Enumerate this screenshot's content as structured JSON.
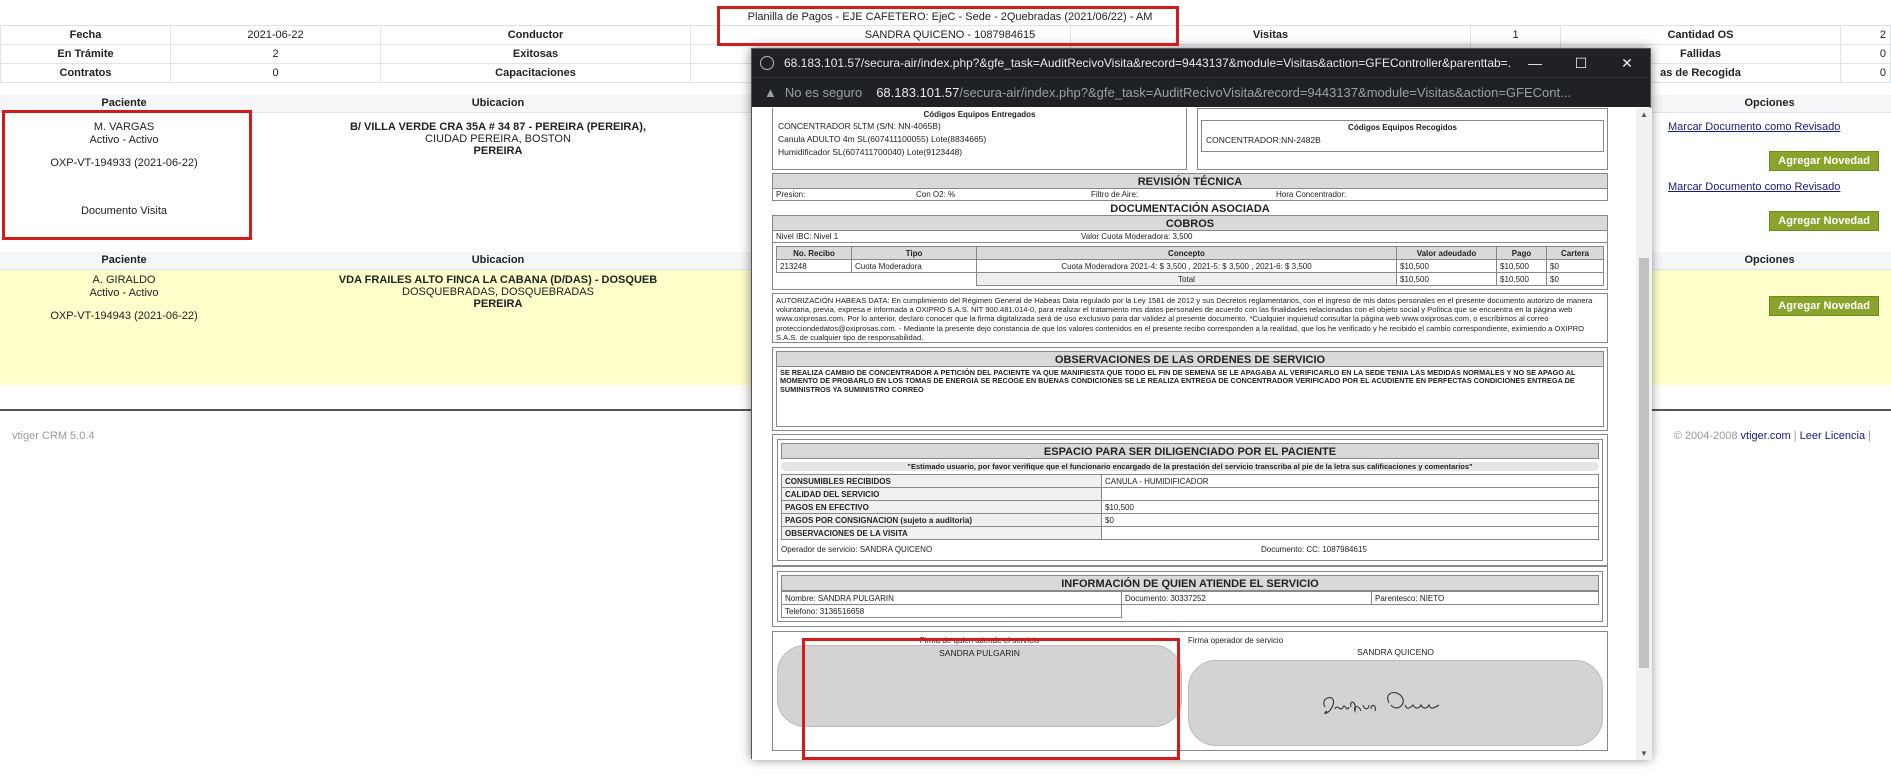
{
  "header": {
    "title": "Planilla de Pagos - EJE CAFETERO: EjeC - Sede - 2Quebradas (2021/06/22) - AM",
    "operator": "SANDRA QUICENO - 1087984615",
    "rows": [
      {
        "c1": "Fecha",
        "c2": "2021-06-22",
        "c3": "Conductor",
        "c4": "",
        "c5": "Visitas",
        "c6": "1",
        "c7": "Cantidad OS",
        "c8": "2"
      },
      {
        "c1": "En Trámite",
        "c2": "2",
        "c3": "Exitosas",
        "c4": "",
        "c5": "",
        "c6": "",
        "c7": "Fallidas",
        "c8": "0"
      },
      {
        "c1": "Contratos",
        "c2": "0",
        "c3": "Capacitaciones",
        "c4": "",
        "c5": "",
        "c6": "",
        "c7": "as de Recogida",
        "c8": "0"
      }
    ]
  },
  "table": {
    "col_paciente": "Paciente",
    "col_ubicacion": "Ubicacion",
    "col_opciones": "Opciones",
    "rows": [
      {
        "name": "M. VARGAS",
        "status": "Activo - Activo",
        "code": "OXP-VT-194933 (2021-06-22)",
        "doc": "Documento Visita",
        "addr1": "B/ VILLA VERDE CRA 35A # 34 87 - PEREIRA (PEREIRA),",
        "addr2": "CIUDAD PEREIRA, BOSTON",
        "addr3": "PEREIRA"
      },
      {
        "name": "A. GIRALDO",
        "status": "Activo - Activo",
        "code": "OXP-VT-194943 (2021-06-22)",
        "addr1": "VDA FRAILES ALTO FINCA LA CABANA (D/DAS) - DOSQUEB",
        "addr2": "DOSQUEBRADAS, DOSQUEBRADAS",
        "addr3": "PEREIRA"
      }
    ],
    "mark_link": "Marcar Documento como Revisado",
    "add_btn": "Agregar Novedad"
  },
  "footer": {
    "left": "vtiger CRM 5.0.4",
    "copy": "© 2004-2008",
    "site": "vtiger.com",
    "license": "Leer Licencia",
    "sep": "|"
  },
  "popup": {
    "title": "68.183.101.57/secura-air/index.php?&gfe_task=AuditRecivoVisita&record=9443137&module=Visitas&action=GFEController&parenttab=...",
    "insecure": "No es seguro",
    "url_host": "68.183.101.57",
    "url_path": "/secura-air/index.php?&gfe_task=AuditRecivoVisita&record=9443137&module=Visitas&action=GFECont...",
    "equip_deliv_title": "Códigos Equipos Entregados",
    "equip_deliv_1": "CONCENTRADOR 5LTM (S/N: NN-4065B)",
    "equip_deliv_2": "Canula ADULTO 4m SL(607411100055) Lote(8834665)",
    "equip_deliv_3": "Humidificador SL(607411700040) Lote(9123448)",
    "equip_pick_title": "Códigos Equipos Recogidos",
    "equip_pick_1": "CONCENTRADOR:NN-2482B",
    "rev_tec": "REVISIÓN TÉCNICA",
    "presion": "Presion:",
    "con_o2": "Con O2: %",
    "filtro": "Filtro de Aire:",
    "hora": "Hora Concentrador:",
    "doc_asoc": "DOCUMENTACIÓN ASOCIADA",
    "cobros": "COBROS",
    "nivel_ibc": "Nivel IBC: Nivel 1",
    "valor_cuota": "Valor Cuota Moderadora: 3,500",
    "cob_headers": [
      "No. Recibo",
      "Tipo",
      "Concepto",
      "Valor adeudado",
      "Pago",
      "Cartera"
    ],
    "cob_row": [
      "213248",
      "Cuota Moderadora",
      "Cuota Moderadora 2021-4: $ 3,500 , 2021-5: $ 3,500 , 2021-6: $ 3,500",
      "$10,500",
      "$10,500",
      "$0"
    ],
    "cob_total": [
      "Total",
      "$10,500",
      "$10,500",
      "$0"
    ],
    "habeas": "AUTORIZACIÓN HABEAS DATA: En cumplimiento del Régimen General de Habeas Data regulado por la Ley 1581 de 2012 y sus Decretos reglamentarios, con el ingreso de mis datos personales en el presente documento autorizo de manera voluntaria, previa, expresa e informada a OXIPRO S.A.S. NIT 900.481.014-0, para realizar el tratamiento mis datos personales de acuerdo con las finalidades relacionadas con el objeto social y Política que se encuentra en la página web www.oxiprosas.com. Por lo anterior, declaro conocer que la firma digitalizada será de uso exclusivo para dar validez al presente documento. *Cualquier inquietud consultar la página web www.oxiprosas.com, o escríbirnos al correo protecciondedatos@oxiprosas.com. - Mediante la presente dejo constancia de que los valores contenidos en el presente recibo corresponden a la realidad, que los he verificado y he recibido el cambio correspondiente, eximiendo a OXIPRO S.A.S. de cualquier tipo de responsabilidad.",
    "obs_title": "OBSERVACIONES DE LAS ORDENES DE SERVICIO",
    "obs_text": "SE REALIZA CAMBIO DE CONCENTRADOR A PETICIÓN DEL PACIENTE YA QUE MANIFIESTA QUE TODO EL FIN DE SEMENA SE LE APAGABA AL VERIFICARLO EN LA SEDE TENIA LAS MEDIDAS NORMALES Y NO SE APAGO AL MOMENTO DE PROBARLO EN LOS TOMAS DE ENERGIA SE RECOGE EN BUENAS CONDICIONES SE LE REALIZA ENTREGA DE CONCENTRADOR VERIFICADO POR EL ACUDIENTE EN PERFECTAS CONDICIONES ENTREGA DE SUMINISTROS YA SUMINISTRO CORREO",
    "espacio_title": "ESPACIO PARA SER DILIGENCIADO POR EL PACIENTE",
    "espacio_note": "\"Estimado usuario, por favor verifique que el funcionario encargado de la prestación del servicio transcriba al pie de la letra sus calificaciones y comentarios\"",
    "esp_rows": [
      {
        "k": "CONSUMIBLES RECIBIDOS",
        "v": "CANULA - HUMIDIFICADOR"
      },
      {
        "k": "CALIDAD DEL SERVICIO",
        "v": ""
      },
      {
        "k": "PAGOS EN EFECTIVO",
        "v": "$10,500"
      },
      {
        "k": "PAGOS POR CONSIGNACION (sujeto a auditoria)",
        "v": "$0"
      },
      {
        "k": "OBSERVACIONES DE LA VISITA",
        "v": ""
      }
    ],
    "operador": "Operador de servicio: SANDRA QUICENO",
    "documento": "Documento: CC: 1087984615",
    "info_title": "INFORMACIÓN DE QUIEN ATIENDE EL SERVICIO",
    "nombre": "Nombre: SANDRA PULGARIN",
    "doc_att": "Documento: 30337252",
    "parentesco": "Parentesco: NIETO",
    "telefono": "Telefono: 3136516658",
    "firma_at_title": "Firma de quien atiende el servicio",
    "firma_at_name": "SANDRA PULGARIN",
    "firma_op_title": "Firma operador de servicio",
    "firma_op_name": "SANDRA QUICENO"
  }
}
